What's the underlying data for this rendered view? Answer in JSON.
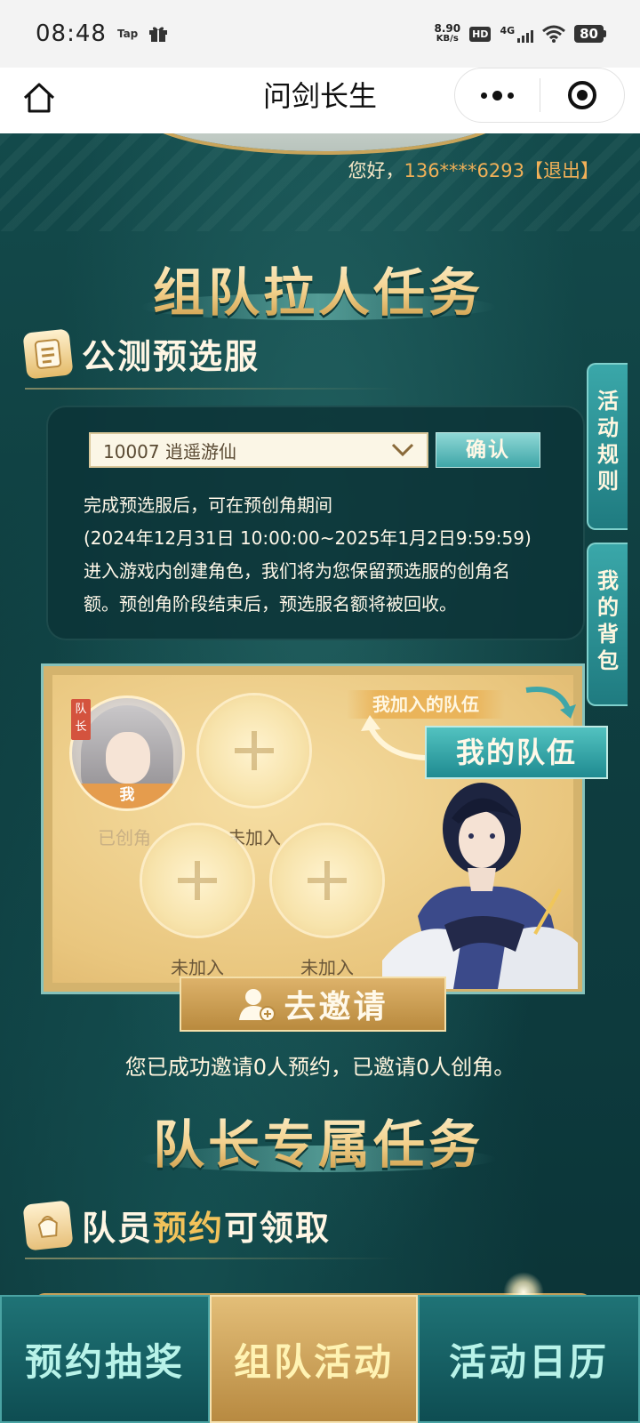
{
  "status_bar": {
    "time": "08:48",
    "tap_label": "Tap",
    "speed_value": "8.90",
    "speed_unit": "KB/s",
    "hd_label": "HD",
    "network": "4G",
    "battery": "80"
  },
  "nav": {
    "title": "问剑长生"
  },
  "header": {
    "greeting": "您好，",
    "phone": "136****6293",
    "logout": "【退出】"
  },
  "team_task": {
    "banner_title": "组队拉人任务",
    "section_title": "公测预选服",
    "server_value": "10007 逍遥游仙",
    "confirm_label": "确认",
    "info_lines": [
      "完成预选服后，可在预创角期间",
      "(2024年12月31日 10:00:00~2025年1月2日9:59:59)",
      "进入游戏内创建角色，我们将为您保留预选服的创角名",
      "额。预创角阶段结束后，预选服名额将被回收。"
    ]
  },
  "side_tabs": {
    "rules": "活动规则",
    "bag": "我的背包"
  },
  "team_panel": {
    "joined_tag": "我加入的队伍",
    "my_team_tab": "我的队伍",
    "captain_badge": "队长",
    "me_label": "我",
    "slots": [
      {
        "status": "已创角"
      },
      {
        "status": "未加入"
      },
      {
        "status": "未加入"
      },
      {
        "status": "未加入"
      }
    ],
    "invite_label": "去邀请",
    "summary": "您已成功邀请0人预约，已邀请0人创角。"
  },
  "captain_task": {
    "banner_title": "队长专属任务",
    "section_title_a": "队员",
    "section_title_b": "预约",
    "section_title_c": "可领取"
  },
  "bottom_nav": {
    "tabs": [
      {
        "label": "预约抽奖"
      },
      {
        "label": "组队活动"
      },
      {
        "label": "活动日历"
      }
    ]
  },
  "colors": {
    "page_bg": "#0f3f42",
    "accent_teal": "#3fa6a8",
    "accent_gold": "#d4b36d",
    "highlight_orange": "#f0b058"
  }
}
